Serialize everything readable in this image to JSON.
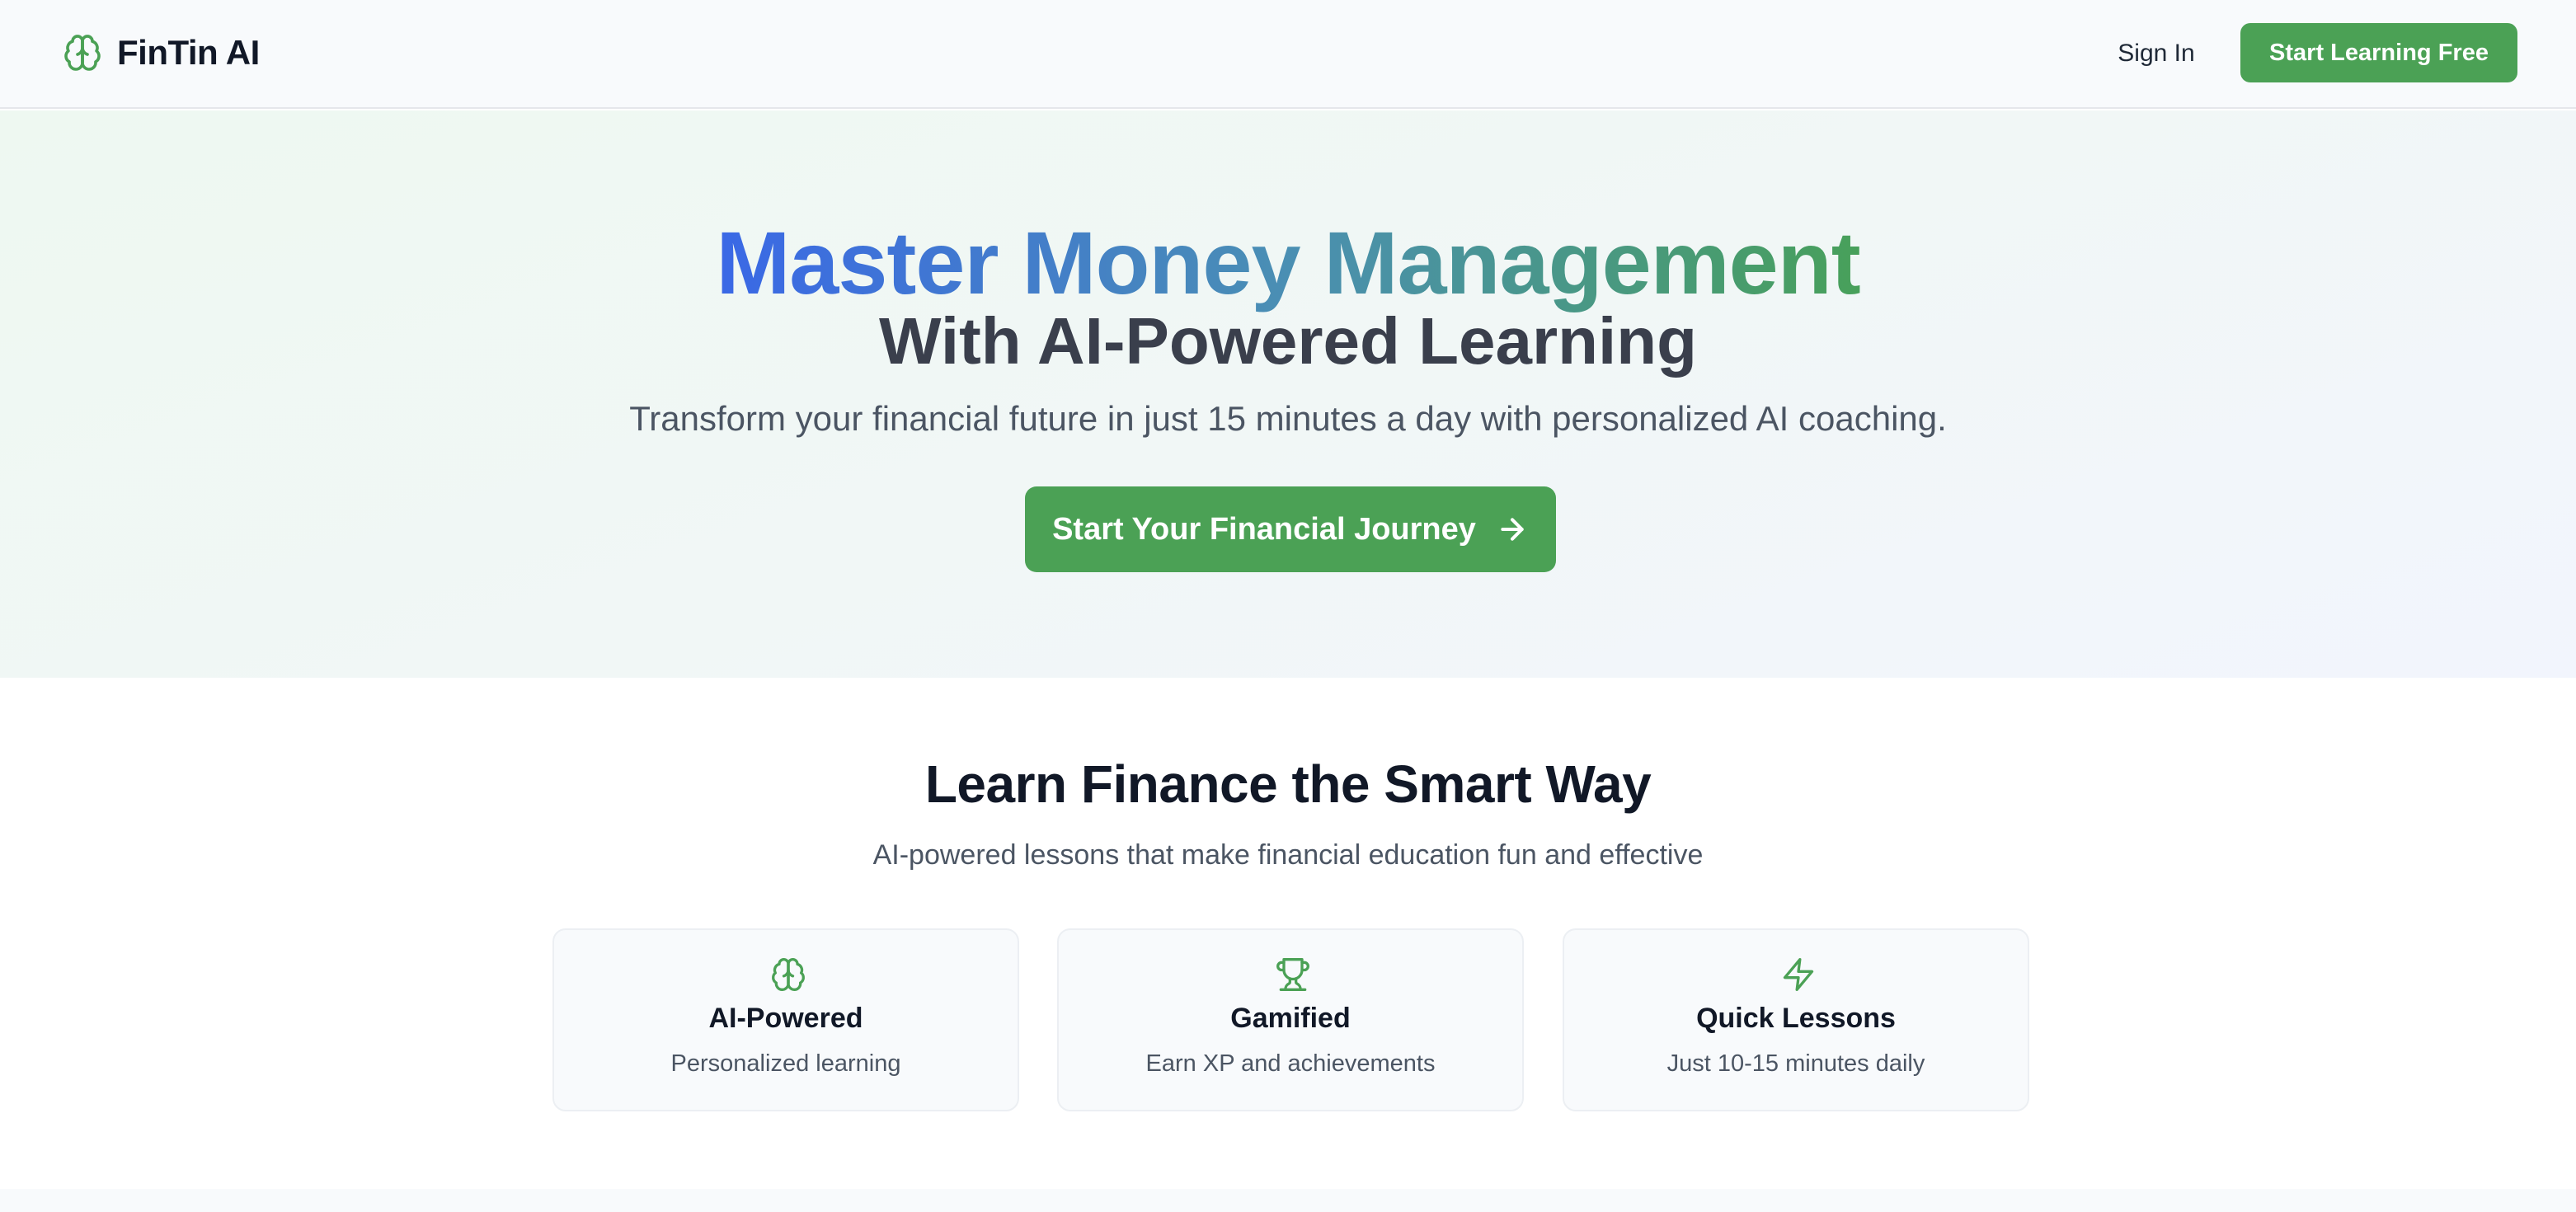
{
  "navbar": {
    "brand": "FinTin AI",
    "brand_icon": "brain-icon",
    "sign_in": "Sign In",
    "cta": "Start Learning Free"
  },
  "hero": {
    "title": "Master Money Management",
    "subtitle": "With AI-Powered Learning",
    "description": "Transform your financial future in just 15 minutes a day with personalized AI coaching.",
    "cta": "Start Your Financial Journey",
    "cta_icon": "arrow-right-icon"
  },
  "features": {
    "title": "Learn Finance the Smart Way",
    "subtitle": "AI-powered lessons that make financial education fun and effective",
    "cards": [
      {
        "icon": "brain-icon",
        "title": "AI-Powered",
        "desc": "Personalized learning"
      },
      {
        "icon": "trophy-icon",
        "title": "Gamified",
        "desc": "Earn XP and achievements"
      },
      {
        "icon": "zap-icon",
        "title": "Quick Lessons",
        "desc": "Just 10-15 minutes daily"
      }
    ]
  },
  "colors": {
    "accent_green": "#4ba155",
    "gradient_blue": "#3a68e6",
    "gradient_green": "#48a05a"
  }
}
